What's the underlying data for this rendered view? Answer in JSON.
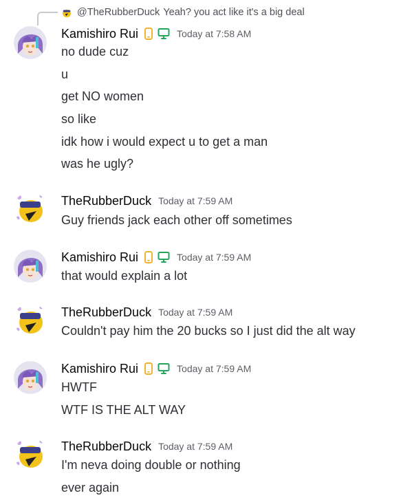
{
  "reply": {
    "author": "@TheRubberDuck",
    "text": "Yeah? you act like it's a big deal"
  },
  "messages": [
    {
      "author": "Kamishiro Rui",
      "timestamp": "Today at 7:58 AM",
      "lines": [
        "no dude cuz",
        "u",
        "get NO women",
        "so like",
        "idk how i would expect u to get a man",
        "was he ugly?"
      ]
    },
    {
      "author": "TheRubberDuck",
      "timestamp": "Today at 7:59 AM",
      "lines": [
        "Guy friends jack each other off sometimes"
      ]
    },
    {
      "author": "Kamishiro Rui",
      "timestamp": "Today at 7:59 AM",
      "lines": [
        "that would explain a lot"
      ]
    },
    {
      "author": "TheRubberDuck",
      "timestamp": "Today at 7:59 AM",
      "lines": [
        "Couldn't pay him the 20 bucks so I just did the alt way"
      ]
    },
    {
      "author": "Kamishiro Rui",
      "timestamp": "Today at 7:59 AM",
      "lines": [
        "HWTF",
        "WTF IS THE ALT WAY"
      ]
    },
    {
      "author": "TheRubberDuck",
      "timestamp": "Today at 7:59 AM",
      "lines": [
        "I'm neva doing double or nothing",
        "ever again"
      ]
    }
  ],
  "icons": {
    "mobile_badge": "mobile-phone-icon",
    "desktop_badge": "desktop-monitor-icon"
  },
  "colors": {
    "mobile_badge": "#f0b232",
    "desktop_badge": "#23a55a",
    "timestamp": "#5c5e66",
    "message_text": "#2e3035"
  }
}
